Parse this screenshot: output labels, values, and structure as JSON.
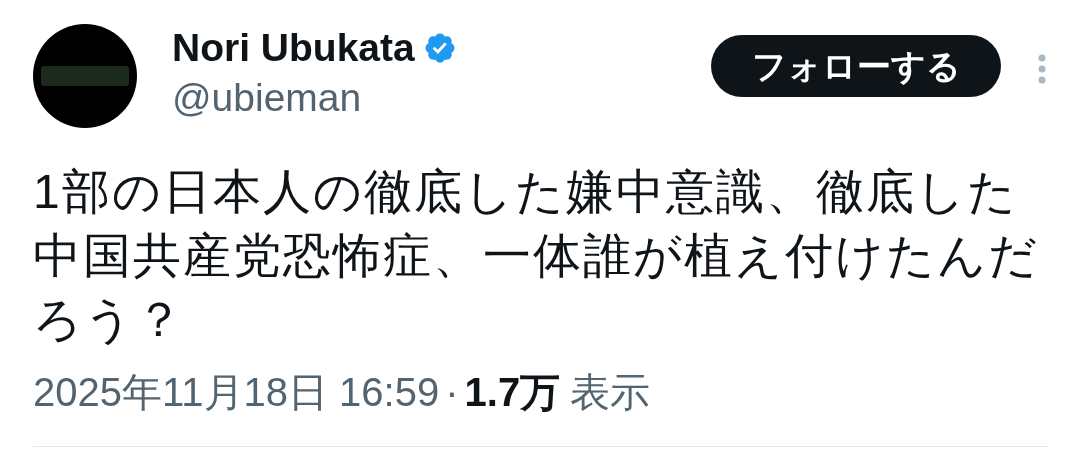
{
  "author": {
    "name": "Nori Ubukata",
    "verified": true,
    "handle": "@ubieman"
  },
  "follow_button": {
    "label": "フォローする"
  },
  "tweet": {
    "text": "1部の日本人の徹底した嫌中意識、徹底した中国共産党恐怖症、一体誰が植え付けたんだろう？"
  },
  "meta": {
    "timestamp": "2025年11月18日 16:59",
    "separator": "·",
    "views": "1.7万",
    "views_label": "表示"
  }
}
